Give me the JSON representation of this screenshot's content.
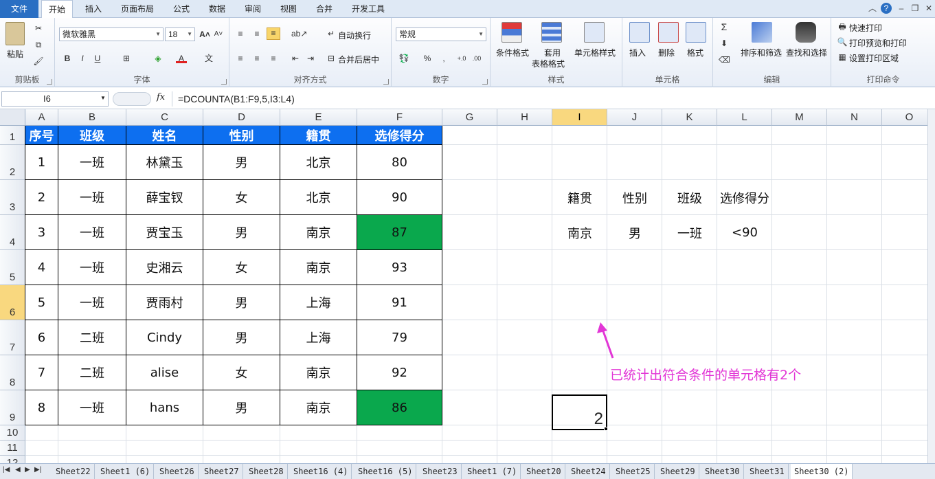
{
  "tabs": [
    "文件",
    "开始",
    "插入",
    "页面布局",
    "公式",
    "数据",
    "审阅",
    "视图",
    "合并",
    "开发工具"
  ],
  "ribbon": {
    "clipboard": {
      "paste": "粘贴",
      "label": "剪贴板"
    },
    "font": {
      "name": "微软雅黑",
      "size": "18",
      "bold": "B",
      "italic": "I",
      "underline": "U",
      "label": "字体"
    },
    "align": {
      "wrap": "自动换行",
      "merge": "合并后居中",
      "label": "对齐方式"
    },
    "number": {
      "format": "常规",
      "percent": "%",
      "comma": ",",
      "label": "数字"
    },
    "styles": {
      "conditional": "条件格式",
      "table1": "套用",
      "table2": "表格格式",
      "cell": "单元格样式",
      "label": "样式"
    },
    "cells": {
      "insert": "插入",
      "delete": "删除",
      "format": "格式",
      "label": "单元格"
    },
    "editing": {
      "sigma": "Σ",
      "sort": "排序和筛选",
      "find": "查找和选择",
      "label": "编辑"
    },
    "print": {
      "quick": "快速打印",
      "preview": "打印预览和打印",
      "area": "设置打印区域",
      "label": "打印命令"
    }
  },
  "namebox": "I6",
  "fx": "fx",
  "formula": "=DCOUNTA(B1:F9,5,I3:L4)",
  "columns": [
    "A",
    "B",
    "C",
    "D",
    "E",
    "F",
    "G",
    "H",
    "I",
    "J",
    "K",
    "L",
    "M",
    "N",
    "O"
  ],
  "rows": [
    "1",
    "2",
    "3",
    "4",
    "5",
    "6",
    "7",
    "8",
    "9",
    "10",
    "11",
    "12"
  ],
  "table": {
    "headers": [
      "序号",
      "班级",
      "姓名",
      "性别",
      "籍贯",
      "选修得分"
    ],
    "rows": [
      [
        "1",
        "一班",
        "林黛玉",
        "男",
        "北京",
        "80"
      ],
      [
        "2",
        "一班",
        "薛宝钗",
        "女",
        "北京",
        "90"
      ],
      [
        "3",
        "一班",
        "贾宝玉",
        "男",
        "南京",
        "87"
      ],
      [
        "4",
        "一班",
        "史湘云",
        "女",
        "南京",
        "93"
      ],
      [
        "5",
        "一班",
        "贾雨村",
        "男",
        "上海",
        "91"
      ],
      [
        "6",
        "二班",
        "Cindy",
        "男",
        "上海",
        "79"
      ],
      [
        "7",
        "二班",
        "alise",
        "女",
        "南京",
        "92"
      ],
      [
        "8",
        "一班",
        "hans",
        "男",
        "南京",
        "86"
      ]
    ],
    "highlight_color": "#0aa84d",
    "header_color": "#0d6ff0"
  },
  "criteria": {
    "headers": [
      "籍贯",
      "性别",
      "班级",
      "选修得分"
    ],
    "values": [
      "南京",
      "男",
      "一班",
      "<90"
    ]
  },
  "result": "2",
  "annotation": "已统计出符合条件的单元格有2个",
  "sheets": [
    "Sheet22",
    "Sheet1 (6)",
    "Sheet26",
    "Sheet27",
    "Sheet28",
    "Sheet16 (4)",
    "Sheet16 (5)",
    "Sheet23",
    "Sheet1 (7)",
    "Sheet20",
    "Sheet24",
    "Sheet25",
    "Sheet29",
    "Sheet30",
    "Sheet31",
    "Sheet30 (2)"
  ],
  "active_sheet": "Sheet30 (2)"
}
